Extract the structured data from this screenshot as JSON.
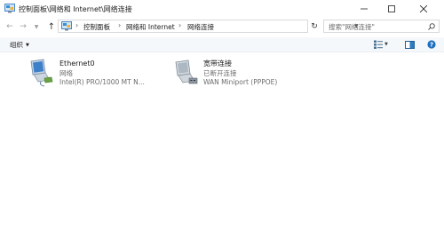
{
  "window": {
    "title": "控制面板\\网络和 Internet\\网络连接"
  },
  "address": {
    "crumbs": [
      "控制面板",
      "网络和 Internet",
      "网络连接"
    ]
  },
  "search": {
    "placeholder": "搜索\"网络连接\""
  },
  "toolbar": {
    "organize_label": "组织"
  },
  "connections": [
    {
      "name": "Ethernet0",
      "status": "网络",
      "device": "Intel(R) PRO/1000 MT N...",
      "icon": "ethernet-adapter-icon"
    },
    {
      "name": "宽带连接",
      "status": "已断开连接",
      "device": "WAN Miniport (PPPOE)",
      "icon": "broadband-connection-icon"
    }
  ],
  "colors": {
    "toolbar_bg": "#f5f8fb",
    "accent": "#0063b1",
    "text": "#1a1a1a",
    "secondary_text": "#6d6d6d"
  }
}
